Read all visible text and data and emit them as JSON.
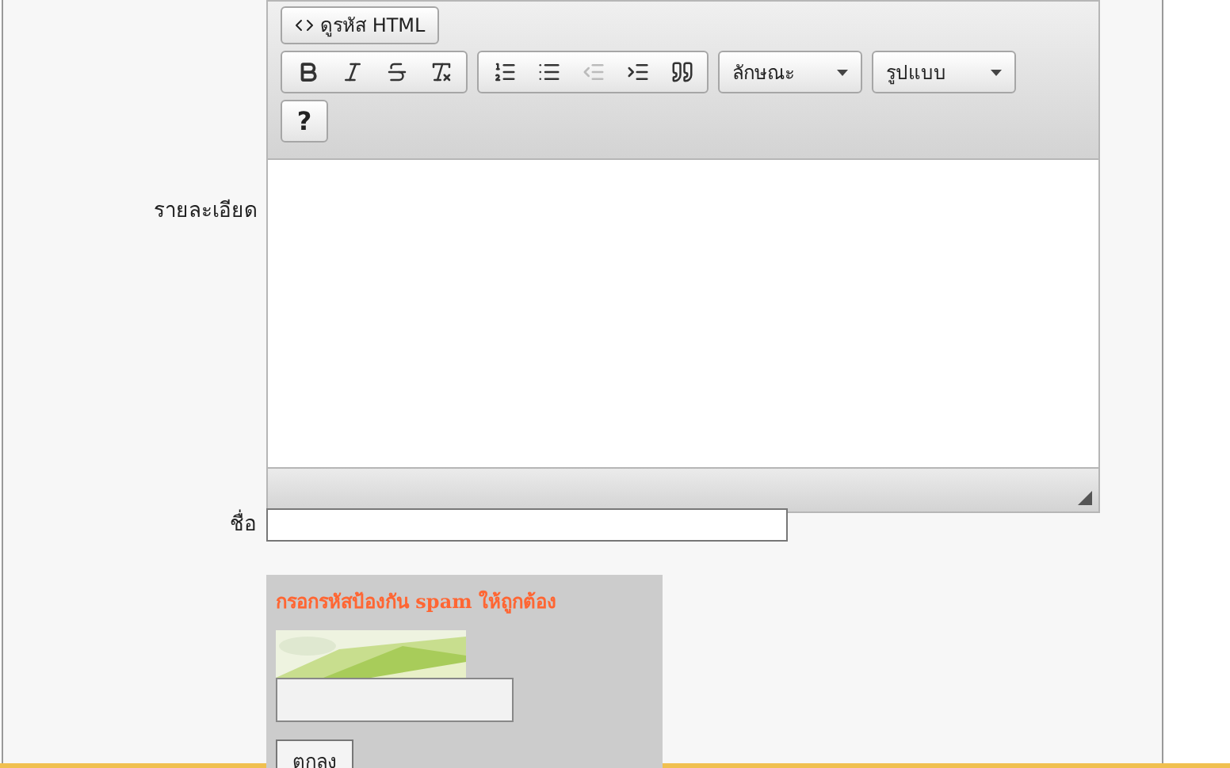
{
  "editor": {
    "label": "รายละเอียด",
    "source_button": "ดูรหัส HTML",
    "toolbar_groups": [
      [
        {
          "kind": "bold",
          "disabled": false
        },
        {
          "kind": "italic",
          "disabled": false
        },
        {
          "kind": "strike",
          "disabled": false
        },
        {
          "kind": "clear",
          "disabled": false
        }
      ],
      [
        {
          "kind": "numbered",
          "disabled": false
        },
        {
          "kind": "bulleted",
          "disabled": false
        },
        {
          "kind": "outdent",
          "disabled": true
        },
        {
          "kind": "indent",
          "disabled": false
        },
        {
          "kind": "quote",
          "disabled": false
        }
      ]
    ],
    "dropdowns": [
      "ลักษณะ",
      "รูปแบบ"
    ],
    "help_button": "?"
  },
  "name_field": {
    "label": "ชื่อ"
  },
  "captcha": {
    "title": "กรอกรหัสป้องกัน spam ให้ถูกต้อง",
    "submit": "ตกลง"
  }
}
